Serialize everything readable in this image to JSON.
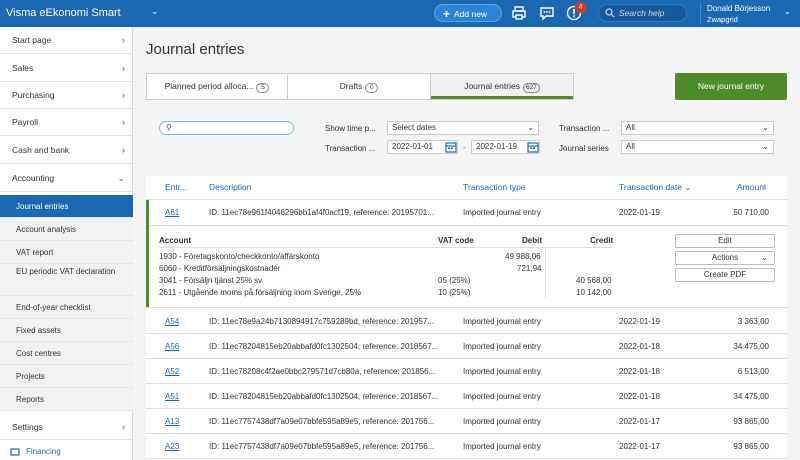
{
  "topbar": {
    "brand": "Visma eEkonomi Smart",
    "add_new": "Add new",
    "notification_count": "4",
    "search_placeholder": "Search help",
    "user_name": "Donald Börjesson",
    "user_company": "Zwapgrid"
  },
  "sidebar": {
    "items": [
      {
        "label": "Start page"
      },
      {
        "label": "Sales"
      },
      {
        "label": "Purchasing"
      },
      {
        "label": "Payroll"
      },
      {
        "label": "Cash and bank"
      },
      {
        "label": "Accounting"
      }
    ],
    "sub_items": [
      {
        "label": "Journal entries"
      },
      {
        "label": "Account analysis"
      },
      {
        "label": "VAT report"
      },
      {
        "label": "EU periodic VAT declaration"
      },
      {
        "label": "End-of-year checklist"
      },
      {
        "label": "Fixed assets"
      },
      {
        "label": "Cost centres"
      },
      {
        "label": "Projects"
      },
      {
        "label": "Reports"
      }
    ],
    "settings": "Settings",
    "financing": "Financing"
  },
  "main": {
    "title": "Journal entries",
    "tabs": [
      {
        "label": "Planned period alloca...",
        "count": "5"
      },
      {
        "label": "Drafts",
        "count": "0"
      },
      {
        "label": "Journal entries",
        "count": "627"
      }
    ],
    "new_button": "New journal entry"
  },
  "filters": {
    "show_time_label": "Show time p...",
    "show_time_value": "Select dates",
    "transaction_date_label": "Transaction ...",
    "date_from": "2022-01-01",
    "date_to": "2022-01-19",
    "transaction_type_label": "Transaction ...",
    "transaction_type_value": "All",
    "journal_series_label": "Journal series",
    "journal_series_value": "All"
  },
  "table": {
    "headers": {
      "entry": "Entr...",
      "description": "Description",
      "transaction_type": "Transaction type",
      "transaction_date": "Transaction date",
      "amount": "Amount"
    },
    "expanded": {
      "id": "A61",
      "description": "ID: 11ec78e961f4046296bb1af4f0acf19, reference: 20195701...",
      "type": "Imported journal entry",
      "date": "2022-01-19",
      "amount": "50 710,00",
      "col_account": "Account",
      "col_vat": "VAT code",
      "col_debit": "Debit",
      "col_credit": "Credit",
      "lines": [
        {
          "account": "1930 - Företagskonto/checkkonto/affärskonto",
          "vat": "",
          "debit": "49 988,06",
          "credit": ""
        },
        {
          "account": "6060 - Kreditförsäljningskostnader",
          "vat": "",
          "debit": "721,94",
          "credit": ""
        },
        {
          "account": "3041 - Försäljn tjänst 25% sv",
          "vat": "05 (25%)",
          "debit": "",
          "credit": "40 568,00"
        },
        {
          "account": "2611 - Utgående moms på försäljning inom Sverige, 25%",
          "vat": "10 (25%)",
          "debit": "",
          "credit": "10 142,00"
        }
      ],
      "edit": "Edit",
      "actions": "Actions",
      "create_pdf": "Create PDF"
    },
    "rows": [
      {
        "id": "A54",
        "description": "ID: 11ec78e9a24b7130894917c759289bd, reference: 201957...",
        "type": "Imported journal entry",
        "date": "2022-01-19",
        "amount": "3 363,00"
      },
      {
        "id": "A56",
        "description": "ID: 11ec78204815eb20abbafd0fc1302504, reference: 2018567...",
        "type": "Imported journal entry",
        "date": "2022-01-18",
        "amount": "34 475,00"
      },
      {
        "id": "A52",
        "description": "ID: 11ec78208c4f2ae0bbc279571d7cb80a, reference: 201856...",
        "type": "Imported journal entry",
        "date": "2022-01-18",
        "amount": "6 513,00"
      },
      {
        "id": "A51",
        "description": "ID: 11ec78204815eb20abbafd0fc1302504, reference: 2018567...",
        "type": "Imported journal entry",
        "date": "2022-01-18",
        "amount": "34 475,00"
      },
      {
        "id": "A13",
        "description": "ID: 11ec7757438df7a09e07bbfe595a89e5, reference: 201756...",
        "type": "Imported journal entry",
        "date": "2022-01-17",
        "amount": "93 865,00"
      },
      {
        "id": "A23",
        "description": "ID: 11ec7757438df7a09e07bbfe595a89e5, reference: 201756...",
        "type": "Imported journal entry",
        "date": "2022-01-17",
        "amount": "93 865,00"
      }
    ]
  }
}
